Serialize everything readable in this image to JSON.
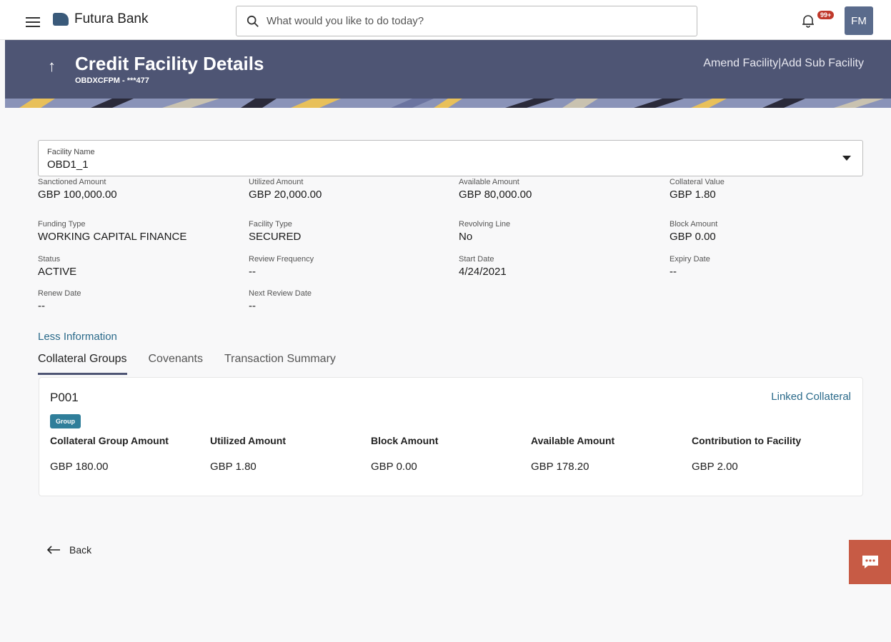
{
  "header": {
    "brand": "Futura Bank",
    "search_placeholder": "What would you like to do today?",
    "notif_badge": "99+",
    "avatar_initials": "FM"
  },
  "hero": {
    "title": "Credit Facility Details",
    "subtitle": "OBDXCFPM - ***477",
    "action_amend": "Amend Facility",
    "separator": "|",
    "action_add_sub": "Add Sub Facility"
  },
  "facility": {
    "label": "Facility Name",
    "value": "OBD1_1"
  },
  "details": [
    {
      "label": "Sanctioned Amount",
      "value": "GBP 100,000.00"
    },
    {
      "label": "Utilized Amount",
      "value": "GBP 20,000.00"
    },
    {
      "label": "Available Amount",
      "value": "GBP 80,000.00"
    },
    {
      "label": "Collateral Value",
      "value": "GBP 1.80"
    },
    {
      "label": "Funding Type",
      "value": "WORKING CAPITAL FINANCE"
    },
    {
      "label": "Facility Type",
      "value": "SECURED"
    },
    {
      "label": "Revolving Line",
      "value": "No"
    },
    {
      "label": "Block Amount",
      "value": "GBP 0.00"
    },
    {
      "label": "Status",
      "value": "ACTIVE"
    },
    {
      "label": "Review Frequency",
      "value": "--"
    },
    {
      "label": "Start Date",
      "value": "4/24/2021"
    },
    {
      "label": "Expiry Date",
      "value": "--"
    },
    {
      "label": "Renew Date",
      "value": "--"
    },
    {
      "label": "Next Review Date",
      "value": "--"
    }
  ],
  "less_info": "Less Information",
  "tabs": [
    {
      "label": "Collateral Groups",
      "active": true
    },
    {
      "label": "Covenants",
      "active": false
    },
    {
      "label": "Transaction Summary",
      "active": false
    }
  ],
  "group_card": {
    "title": "P001",
    "linked": "Linked Collateral",
    "badge": "Group",
    "columns": [
      {
        "header": "Collateral Group Amount",
        "value": "GBP 180.00"
      },
      {
        "header": "Utilized Amount",
        "value": "GBP 1.80"
      },
      {
        "header": "Block Amount",
        "value": "GBP 0.00"
      },
      {
        "header": "Available Amount",
        "value": "GBP 178.20"
      },
      {
        "header": "Contribution to Facility",
        "value": "GBP 2.00"
      }
    ]
  },
  "back_label": "Back",
  "colors": {
    "hero_bg": "#4e5574",
    "link": "#2a6a8a",
    "badge": "#2f7e9a",
    "chat": "#c75b45"
  }
}
